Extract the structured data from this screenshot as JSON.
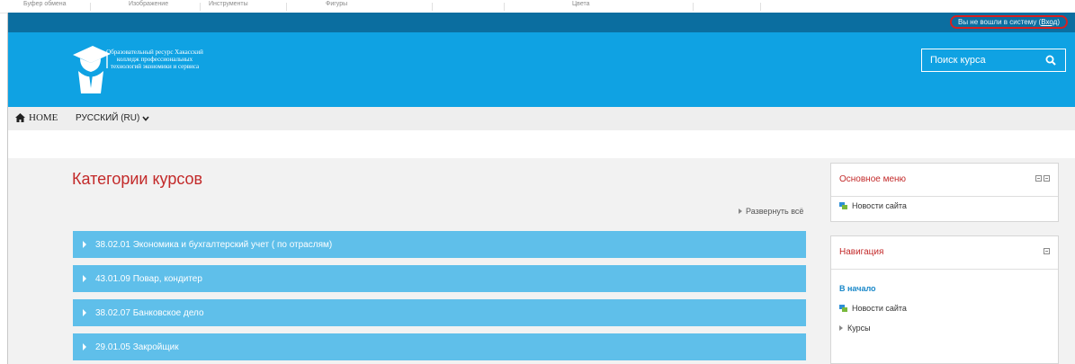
{
  "ribbon": {
    "groups": [
      "Буфер обмена",
      "Изображение",
      "Инструменты",
      "Фигуры",
      "Цвета"
    ]
  },
  "topbar": {
    "login_text": "Вы не вошли в систему (",
    "login_link": "Вход",
    "login_close": ")",
    "highlight_color": "#d81f1f"
  },
  "header": {
    "logo_text": "Образовательный ресурс Хакасский колледж профессиональных технологий экономики и сервиса",
    "search_placeholder": "Поиск курса",
    "search_icon": "search-icon",
    "brand_color": "#0fa2e3"
  },
  "nav": {
    "home_label": "HOME",
    "language_label": "РУССКИЙ (RU)"
  },
  "main": {
    "title": "Категории курсов",
    "expand_all": "Развернуть всё",
    "categories": [
      "38.02.01 Экономика и бухгалтерский учет ( по отраслям)",
      "43.01.09 Повар, кондитер",
      "38.02.07 Банковское дело",
      "29.01.05 Закройщик"
    ]
  },
  "sidebar": {
    "main_menu": {
      "title": "Основное меню",
      "items": [
        "Новости сайта"
      ]
    },
    "navigation": {
      "title": "Навигация",
      "home_link": "В начало",
      "items": [
        "Новости сайта",
        "Курсы"
      ]
    }
  }
}
